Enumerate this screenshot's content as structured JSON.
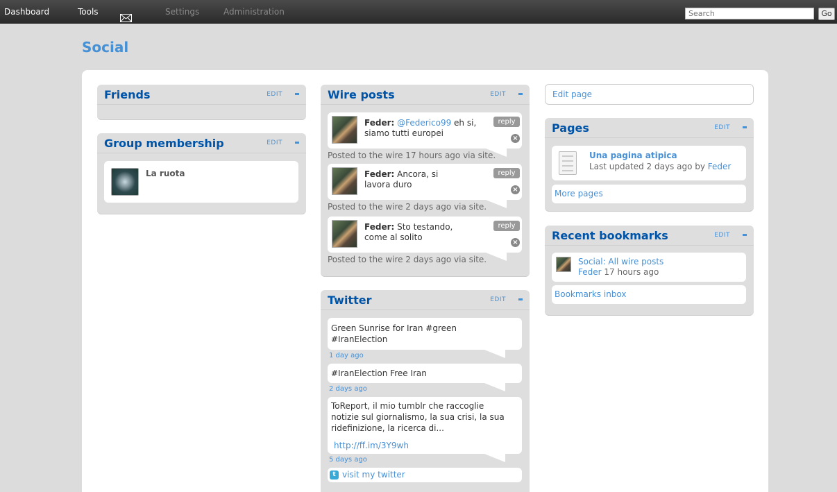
{
  "topbar": {
    "dashboard": "Dashboard",
    "tools": "Tools",
    "settings": "Settings",
    "administration": "Administration",
    "search_placeholder": "Search",
    "go": "Go"
  },
  "page": {
    "title": "Social"
  },
  "widgets": {
    "edit_label": "EDIT",
    "friends": {
      "title": "Friends"
    },
    "group": {
      "title": "Group membership",
      "items": [
        {
          "name": "La ruota"
        }
      ]
    },
    "wire": {
      "title": "Wire posts",
      "reply_label": "reply",
      "posts": [
        {
          "author": "Feder:",
          "mention": "@Federico99",
          "text_rest": " eh si, siamo tutti europei",
          "posted": "Posted to the wire 17 hours ago via site."
        },
        {
          "author": "Feder:",
          "mention": "",
          "text_rest": " Ancora, si lavora duro",
          "posted": "Posted to the wire 2 days ago via site."
        },
        {
          "author": "Feder:",
          "mention": "",
          "text_rest": " Sto testando, come al solito",
          "posted": "Posted to the wire 2 days ago via site."
        }
      ]
    },
    "twitter": {
      "title": "Twitter",
      "tweets": [
        {
          "text": "Green Sunrise for Iran #green #IranElection",
          "link": "",
          "time": "1 day ago"
        },
        {
          "text": "#IranElection Free Iran",
          "link": "",
          "time": "2 days ago"
        },
        {
          "text": "ToReport, il mio tumblr che raccoglie notizie sul giornalismo, la sua crisi, la sua ridefinizione, la ricerca di...",
          "link": "http://ff.im/3Y9wh",
          "time": "5 days ago"
        }
      ],
      "visit": "visit my twitter"
    },
    "edit_page": "Edit page",
    "pages": {
      "title": "Pages",
      "item_title": "Una pagina atipica",
      "item_meta": "Last updated 2 days ago by ",
      "item_author": "Feder",
      "more": "More pages"
    },
    "bookmarks": {
      "title": "Recent bookmarks",
      "item_title": "Social: All wire posts",
      "item_author": "Feder",
      "item_time": " 17 hours ago",
      "inbox": "Bookmarks inbox"
    }
  }
}
